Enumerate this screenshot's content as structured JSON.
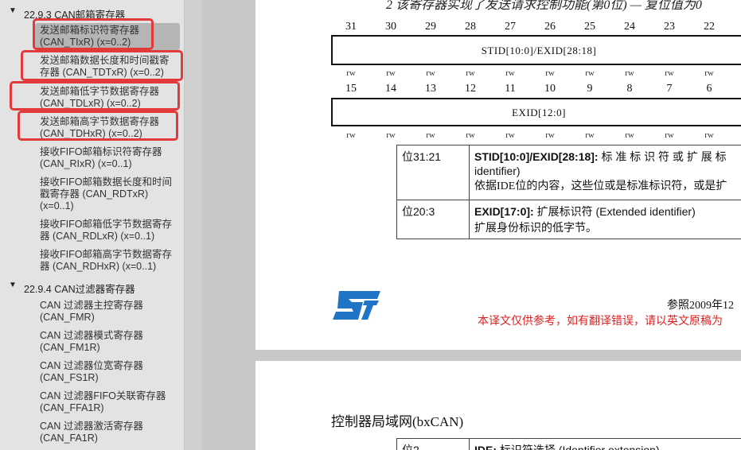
{
  "sidebar": {
    "section1": {
      "label": "22.9.3 CAN邮箱寄存器",
      "arrow": "▼"
    },
    "section2": {
      "label": "22.9.4 CAN过滤器寄存器",
      "arrow": "▼"
    },
    "items": [
      {
        "l1": "发送邮箱标识符寄存器",
        "l2": "(CAN_TIxR) (x=0..2)"
      },
      {
        "l1": "发送邮箱数据长度和时间戳寄",
        "l2": "存器 (CAN_TDTxR) (x=0..2)"
      },
      {
        "l1": "发送邮箱低字节数据寄存器",
        "l2": "(CAN_TDLxR) (x=0..2)"
      },
      {
        "l1": "发送邮箱高字节数据寄存器",
        "l2": "(CAN_TDHxR) (x=0..2)"
      },
      {
        "l1": "接收FIFO邮箱标识符寄存器",
        "l2": "(CAN_RIxR) (x=0..1)"
      },
      {
        "l1": "接收FIFO邮箱数据长度和时间",
        "l2": "戳寄存器 (CAN_RDTxR)",
        "l3": "(x=0..1)"
      },
      {
        "l1": "接收FIFO邮箱低字节数据寄存",
        "l2": "器 (CAN_RDLxR) (x=0..1)"
      },
      {
        "l1": "接收FIFO邮箱高字节数据寄存",
        "l2": "器 (CAN_RDHxR) (x=0..1)"
      },
      {
        "l1": "CAN 过滤器主控寄存器",
        "l2": "(CAN_FMR)"
      },
      {
        "l1": "CAN 过滤器模式寄存器",
        "l2": "(CAN_FM1R)"
      },
      {
        "l1": "CAN 过滤器位宽寄存器",
        "l2": "(CAN_FS1R)"
      },
      {
        "l1": "CAN 过滤器FIFO关联寄存器",
        "l2": "(CAN_FFA1R)"
      },
      {
        "l1": "CAN 过滤器激活寄存器",
        "l2": "(CAN_FA1R)"
      }
    ]
  },
  "page1": {
    "header_text": "2 该寄存器实现了发送请求控制功能(第0位) — 复位值为0",
    "bits_upper": [
      "31",
      "30",
      "29",
      "28",
      "27",
      "26",
      "25",
      "24",
      "23",
      "22"
    ],
    "bits_lower": [
      "15",
      "14",
      "13",
      "12",
      "11",
      "10",
      "9",
      "8",
      "7",
      "6"
    ],
    "rw": "rw",
    "field_upper": "STID[10:0]/EXID[28:18]",
    "field_lower": "EXID[12:0]",
    "table": [
      {
        "bits": "位31:21",
        "title": "STID[10:0]/EXID[28:18]:",
        "title_rest": " 标 准 标 识 符 或 扩 展 标",
        "line2": "identifier)",
        "line3": "依据IDE位的内容，这些位或是标准标识符，或是扩"
      },
      {
        "bits": "位20:3",
        "title": "EXID[17:0]:",
        "title_rest": " 扩展标识符 (Extended identifier)",
        "line2": "扩展身份标识的低字节。"
      }
    ],
    "ref_text": "参照2009年12",
    "disclaimer": "本译文仅供参考，如有翻译错误，请以英文原稿为"
  },
  "page2": {
    "title": "控制器局域网(bxCAN)",
    "row_bits": "位2",
    "row_title": "IDE:",
    "row_rest": " 标识符选择 (Identifier extension)"
  },
  "colors": {
    "highlight": "#e23a3a",
    "st_logo": "#1f74c6",
    "disclaimer": "#e02020"
  }
}
